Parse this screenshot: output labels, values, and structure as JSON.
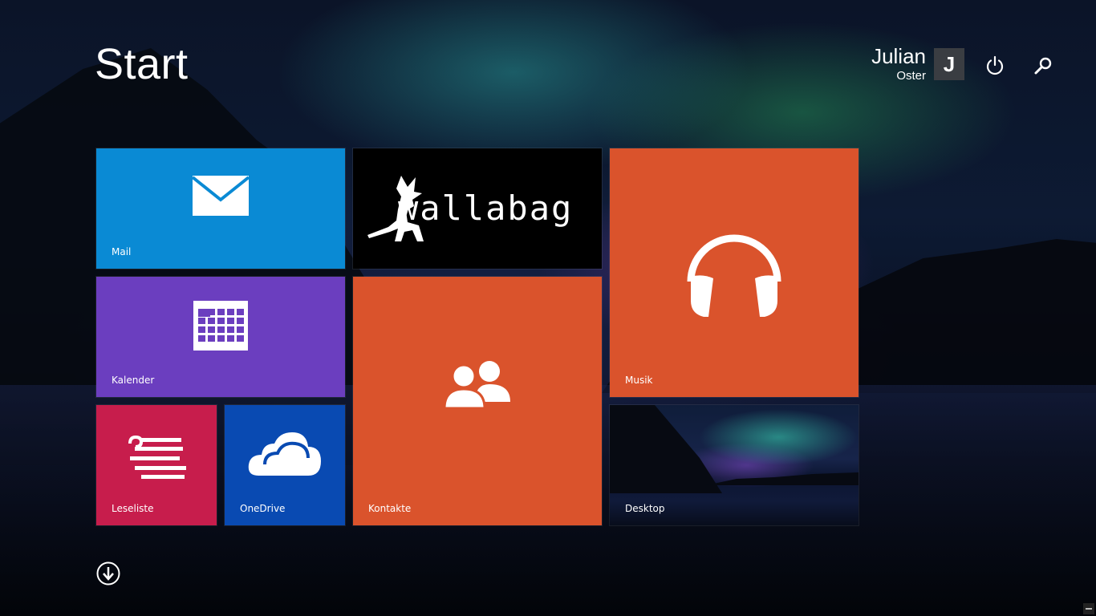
{
  "header": {
    "title": "Start",
    "user": {
      "first_name": "Julian",
      "last_name": "Oster",
      "avatar_letter": "J"
    },
    "power_icon": "power-icon",
    "search_icon": "search-icon"
  },
  "tiles": [
    {
      "id": "mail",
      "label": "Mail",
      "icon": "mail-envelope-icon",
      "color": "#0a8ad4"
    },
    {
      "id": "wallabag",
      "label": "",
      "logo_text": "wallabag",
      "icon": "wallabag-kangaroo-logo",
      "color": "#000000"
    },
    {
      "id": "musik",
      "label": "Musik",
      "icon": "headphones-icon",
      "color": "#da532c"
    },
    {
      "id": "kalender",
      "label": "Kalender",
      "icon": "calendar-icon",
      "color": "#6b3ebf"
    },
    {
      "id": "kontakte",
      "label": "Kontakte",
      "icon": "people-icon",
      "color": "#da532c"
    },
    {
      "id": "leseliste",
      "label": "Leseliste",
      "icon": "reading-list-icon",
      "color": "#c71d4c"
    },
    {
      "id": "onedrive",
      "label": "OneDrive",
      "icon": "cloud-icon",
      "color": "#094ab2"
    },
    {
      "id": "desktop",
      "label": "Desktop",
      "icon": "desktop-wallpaper-thumbnail"
    }
  ],
  "footer": {
    "all_apps_icon": "arrow-down-circle-icon"
  }
}
